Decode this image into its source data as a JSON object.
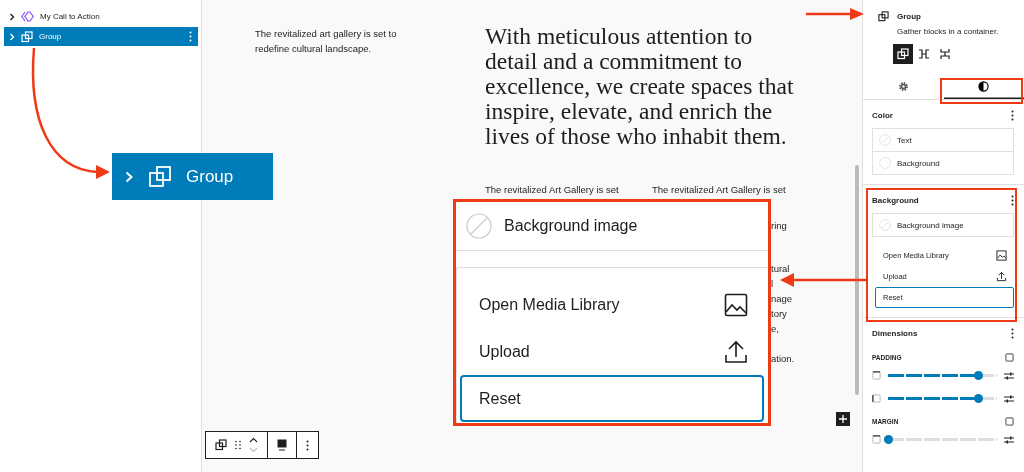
{
  "list_view": {
    "items": [
      {
        "label": "My Call to Action",
        "kind": "pattern",
        "selected": false
      },
      {
        "label": "Group",
        "kind": "group",
        "selected": true
      }
    ]
  },
  "canvas": {
    "intro": "The revitalized art gallery is set to redefine cultural landscape.",
    "heading": "With meticulous attention to detail and a commitment to excellence, we create spaces that inspire, elevate, and enrich the lives of those who inhabit them.",
    "column_1": "The revitalized Art Gallery is set",
    "column_2": "The revitalized Art Gallery is set",
    "column_2_fragments": [
      "ring",
      "tural",
      "l",
      "nage",
      "tory",
      "e,",
      "ation."
    ]
  },
  "callout_group": {
    "label": "Group"
  },
  "callout_background": {
    "title": "Background image",
    "menu": [
      {
        "label": "Open Media Library",
        "kind": "image",
        "focused": false
      },
      {
        "label": "Upload",
        "kind": "upload",
        "focused": false
      },
      {
        "label": "Reset",
        "kind": "none",
        "focused": true
      }
    ]
  },
  "sidebar": {
    "block": {
      "title": "Group",
      "description": "Gather blocks in a container."
    },
    "variations": [
      {
        "kind": "group",
        "selected": true
      },
      {
        "kind": "row",
        "selected": false
      },
      {
        "kind": "stack",
        "selected": false
      }
    ],
    "tabs": [
      {
        "kind": "settings",
        "selected": false
      },
      {
        "kind": "styles",
        "selected": true
      }
    ],
    "color": {
      "title": "Color",
      "items": [
        {
          "label": "Text",
          "kind": "none"
        },
        {
          "label": "Background",
          "kind": "empty"
        }
      ]
    },
    "background": {
      "title": "Background",
      "image_label": "Background image",
      "menu": [
        {
          "label": "Open Media Library",
          "kind": "image",
          "focused": false
        },
        {
          "label": "Upload",
          "kind": "upload",
          "focused": false
        },
        {
          "label": "Reset",
          "kind": "none",
          "focused": true
        }
      ]
    },
    "dimensions": {
      "title": "Dimensions",
      "padding_label": "PADDING",
      "padding": [
        {
          "level": 0.83
        },
        {
          "level": 0.83
        }
      ],
      "margin_label": "MARGIN",
      "margin": [
        {
          "level": 0
        }
      ]
    }
  }
}
